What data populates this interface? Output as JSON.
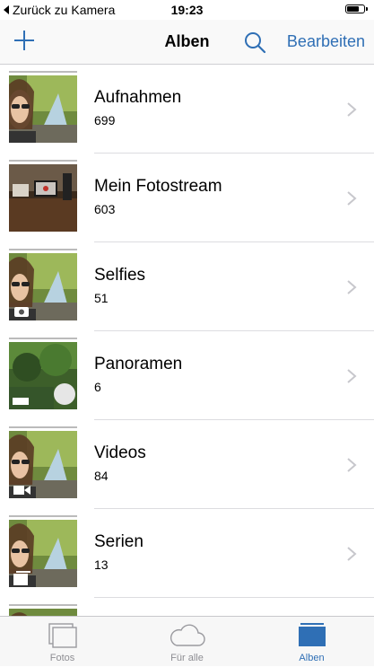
{
  "status_bar": {
    "back_label": "Zurück zu Kamera",
    "time": "19:23"
  },
  "nav": {
    "title": "Alben",
    "edit_label": "Bearbeiten"
  },
  "albums": [
    {
      "title": "Aufnahmen",
      "count": "699"
    },
    {
      "title": "Mein Fotostream",
      "count": "603"
    },
    {
      "title": "Selfies",
      "count": "51"
    },
    {
      "title": "Panoramen",
      "count": "6"
    },
    {
      "title": "Videos",
      "count": "84"
    },
    {
      "title": "Serien",
      "count": "13"
    }
  ],
  "tabs": [
    {
      "label": "Fotos"
    },
    {
      "label": "Für alle"
    },
    {
      "label": "Alben"
    }
  ],
  "colors": {
    "accent": "#2f6fb5",
    "inactive_tab": "#8e8e93"
  }
}
